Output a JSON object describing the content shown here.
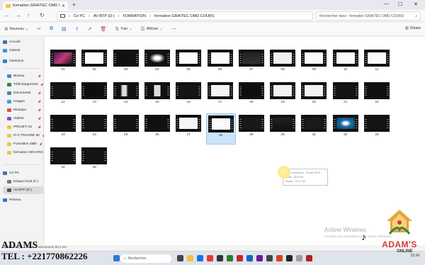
{
  "tab": {
    "title": "formation GRAITEC OMD COU",
    "close": "✕",
    "new": "+"
  },
  "window": {
    "min": "—",
    "max": "☐",
    "close": "✕"
  },
  "address": {
    "crumbs": [
      "Ce PC",
      "AV-BTP (D:)",
      "FORMATION",
      "formation GRAITEC OMD COURS"
    ],
    "sep": "›",
    "search_placeholder": "Rechercher dans : formation GRAITEC OMD COURS"
  },
  "commands": [
    {
      "label": "Nouveau",
      "icon": "⊕"
    },
    {
      "label": "",
      "icon": "✂"
    },
    {
      "label": "",
      "icon": "⧉"
    },
    {
      "label": "",
      "icon": "▤"
    },
    {
      "label": "",
      "icon": "⇪"
    },
    {
      "label": "",
      "icon": "↗"
    },
    {
      "label": "",
      "icon": "🗑"
    },
    {
      "label": "Trier",
      "icon": "⇅"
    },
    {
      "label": "Afficher",
      "icon": "☰"
    },
    {
      "label": "",
      "icon": "⋯"
    }
  ],
  "details_label": "Détails",
  "sidebar": [
    {
      "label": "Accueil",
      "color": "#3b6fb6",
      "pin": false
    },
    {
      "label": "Galerie",
      "color": "#2f9ad6",
      "pin": false
    },
    {
      "label": "OneDrive",
      "color": "#2b7cd3",
      "pin": false
    },
    {
      "label": "Bureau",
      "color": "#3a8be0",
      "pin": true
    },
    {
      "label": "Téléchargement",
      "color": "#2a8a4a",
      "pin": true
    },
    {
      "label": "Documents",
      "color": "#5a7fa8",
      "pin": true
    },
    {
      "label": "Images",
      "color": "#3aa0d8",
      "pin": true
    },
    {
      "label": "Musique",
      "color": "#e05050",
      "pin": true
    },
    {
      "label": "Vidéos",
      "color": "#8a4ac8",
      "pin": true
    },
    {
      "label": "PROJET  ISI",
      "color": "#f0c24b",
      "pin": true
    },
    {
      "label": "R+2 TRAORE Mr",
      "color": "#f0c24b",
      "pin": true
    },
    {
      "label": "Formation dalle",
      "color": "#f0c24b",
      "pin": true
    },
    {
      "label": "formation GRAITEC",
      "color": "#f0c24b",
      "pin": false
    },
    {
      "label": "Ce PC",
      "color": "#4a6ea8",
      "pin": false
    },
    {
      "label": "Disque local (C:)",
      "color": "#777777",
      "pin": false
    },
    {
      "label": "AV-BTP (D:)",
      "color": "#555555",
      "pin": false
    },
    {
      "label": "Réseau",
      "color": "#2b7cd3",
      "pin": false
    }
  ],
  "files": [
    "01",
    "02",
    "03",
    "04",
    "05",
    "06",
    "07",
    "08",
    "09",
    "10",
    "11",
    "12",
    "13",
    "14",
    "15",
    "16",
    "17",
    "18",
    "19",
    "20",
    "21",
    "22",
    "23",
    "24",
    "25",
    "26",
    "27",
    "28",
    "29",
    "30",
    "31",
    "32",
    "33",
    "34",
    "35"
  ],
  "selected_file": "28",
  "tooltip": {
    "type": "Type d'élément : Fichier MP4",
    "size": "Taille : 65,5 Mo",
    "duration": "Durée : 00:17:02"
  },
  "status_text": "35 élément(s)    1 élément sélectionné  65,2 Mo",
  "activate": {
    "title": "Activer Windows",
    "sub": "Accédez aux paramètres pour activer Windows."
  },
  "taskbar": {
    "search": "Rechercher",
    "time": "15:34",
    "date": "..."
  },
  "overlay": {
    "name": "ADAMS",
    "phone": "TEL : +221770862226",
    "brand": "ADAM'S",
    "brand_sub": "ONLINE"
  }
}
